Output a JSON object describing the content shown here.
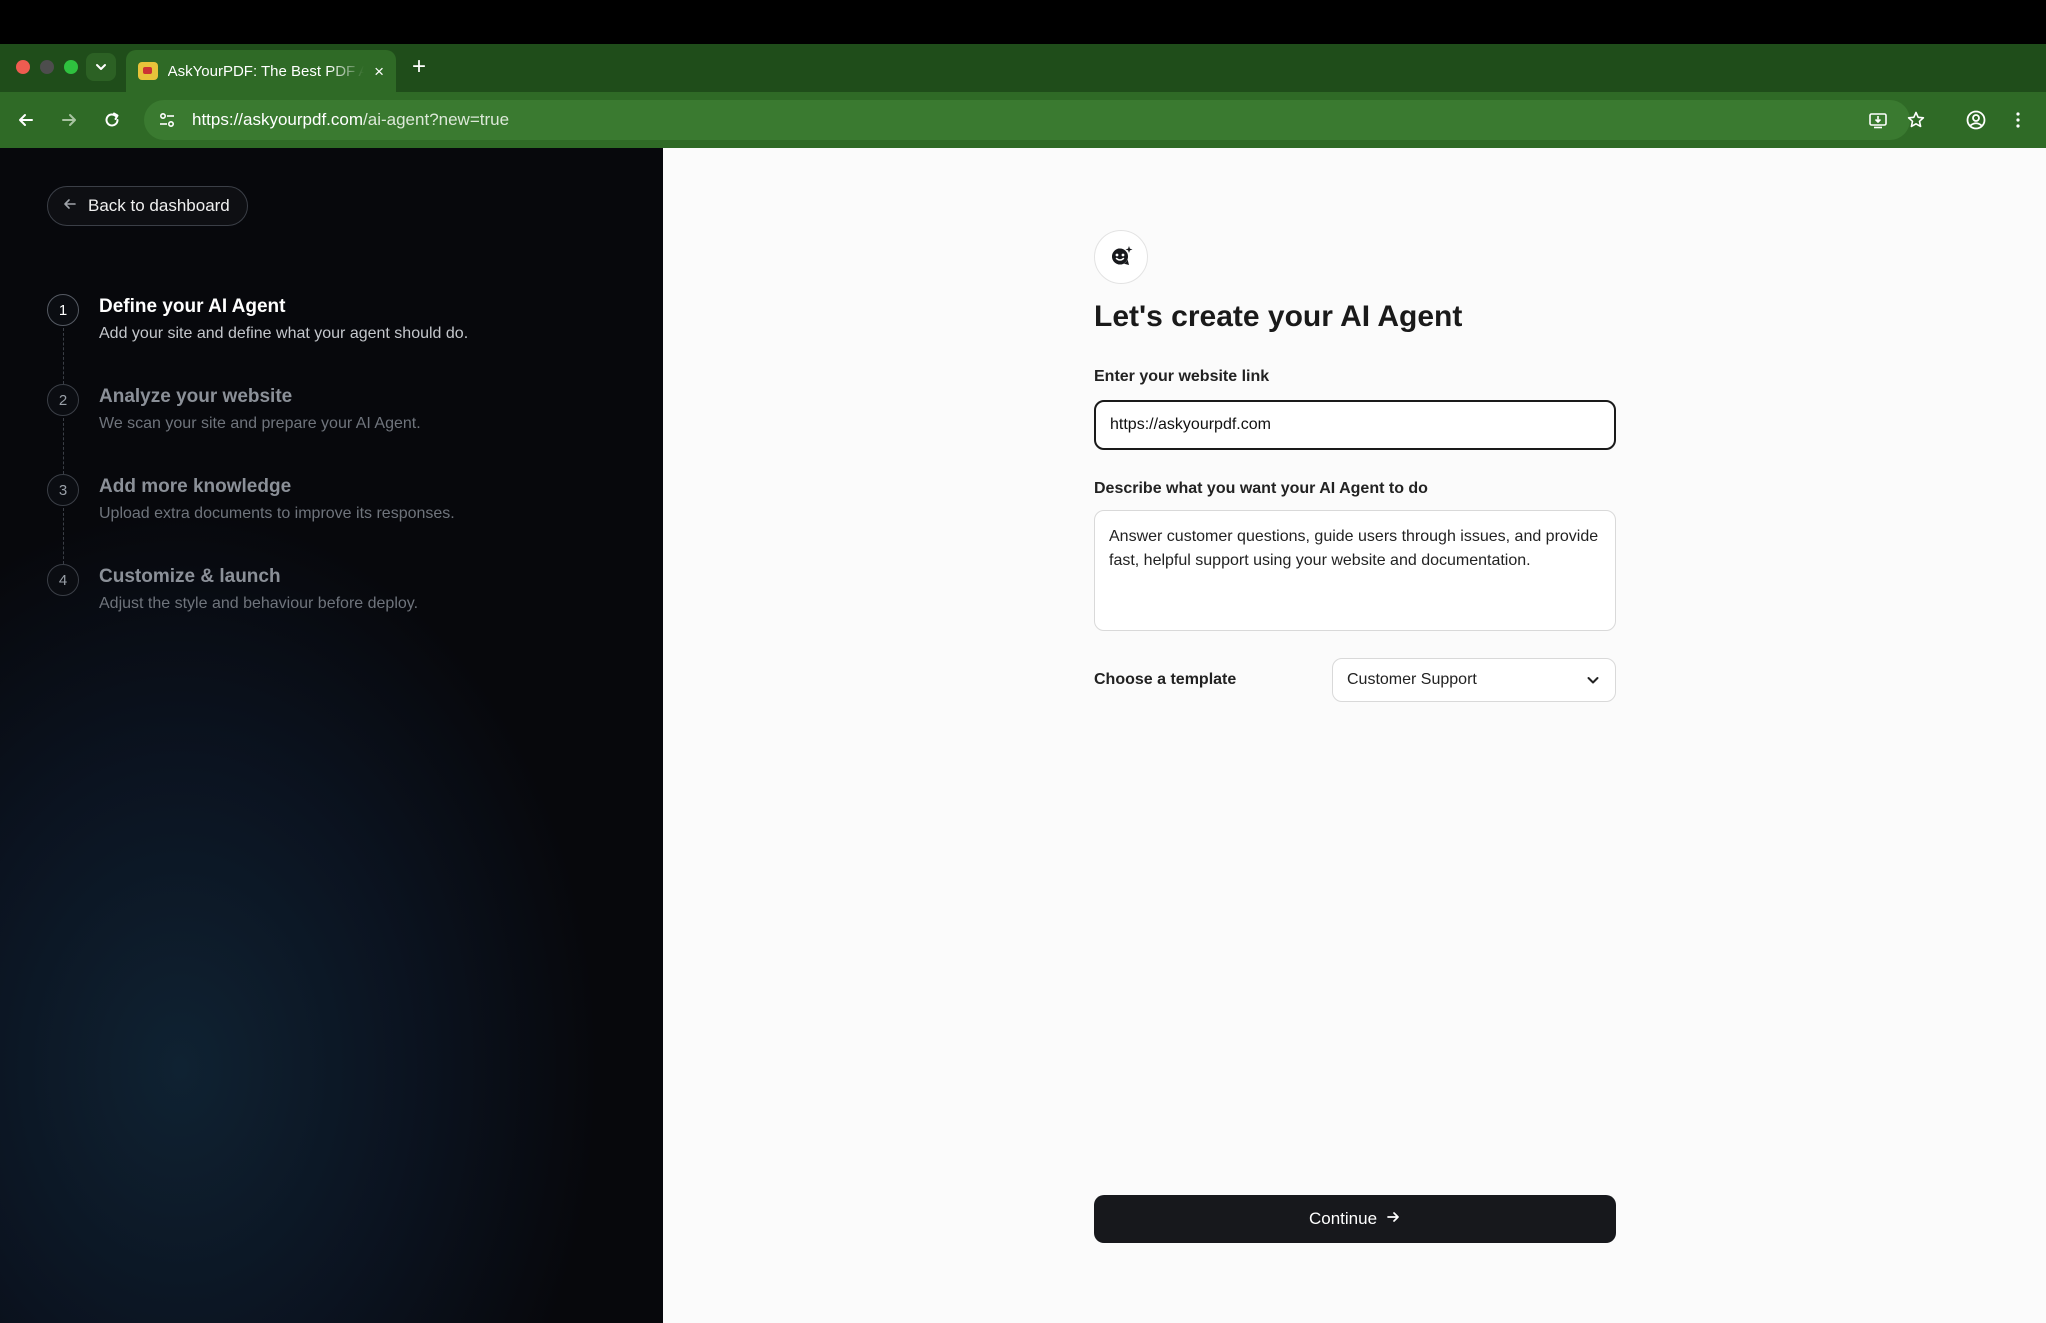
{
  "browser": {
    "tab_title": "AskYourPDF: The Best PDF AI",
    "tab_close": "×",
    "new_tab": "+",
    "url_host": "https://askyourpdf.com",
    "url_path": "/ai-agent?new=true"
  },
  "sidebar": {
    "back_label": "Back to dashboard",
    "steps": [
      {
        "number": "1",
        "title": "Define your AI Agent",
        "description": "Add your site and define what your agent should do."
      },
      {
        "number": "2",
        "title": "Analyze your website",
        "description": "We scan your site and prepare your AI Agent."
      },
      {
        "number": "3",
        "title": "Add more knowledge",
        "description": "Upload extra documents to improve its responses."
      },
      {
        "number": "4",
        "title": "Customize & launch",
        "description": "Adjust the style and behaviour before deploy."
      }
    ]
  },
  "main": {
    "title": "Let's create your AI Agent",
    "website_label": "Enter your website link",
    "website_value": "https://askyourpdf.com",
    "description_label": "Describe what you want your AI Agent to do",
    "description_value": "Answer customer questions, guide users through issues, and provide fast, helpful support using your website and documentation.",
    "template_label": "Choose a template",
    "template_value": "Customer Support",
    "continue_label": "Continue"
  },
  "icons": {
    "back": "arrow-left-icon",
    "forward": "arrow-right-icon",
    "reload": "reload-icon",
    "site_info": "tune-icon",
    "install": "install-app-icon",
    "bookmark": "star-icon",
    "profile": "profile-icon",
    "menu": "kebab-menu-icon",
    "logo": "chat-sparkle-icon",
    "dropdown": "chevron-down-icon"
  }
}
